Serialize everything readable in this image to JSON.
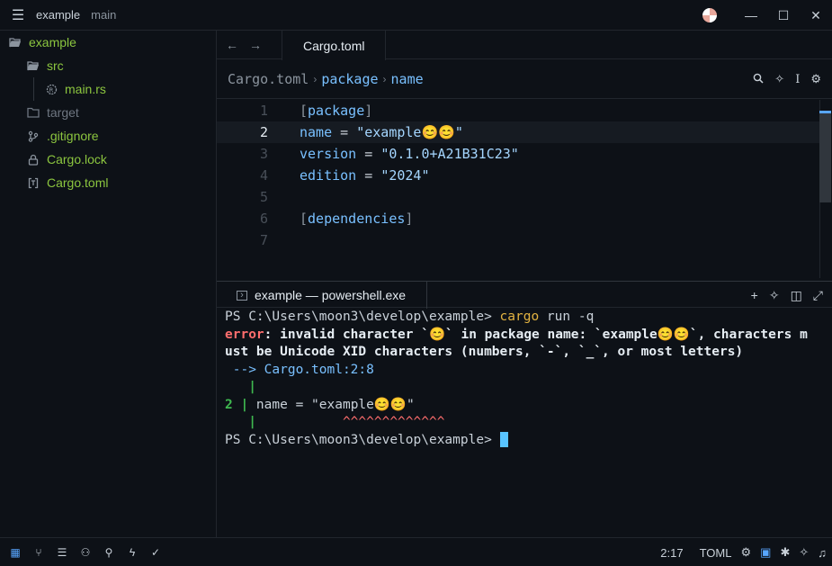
{
  "titlebar": {
    "project": "example",
    "branch": "main"
  },
  "sidebar": {
    "items": [
      {
        "label": "example",
        "icon": "folder-open-icon",
        "color": "#8cc63f"
      },
      {
        "label": "src",
        "icon": "folder-open-icon",
        "color": "#8cc63f"
      },
      {
        "label": "main.rs",
        "icon": "rust-icon",
        "color": "#8cc63f"
      },
      {
        "label": "target",
        "icon": "folder-icon",
        "color": "#6e7681"
      },
      {
        "label": ".gitignore",
        "icon": "git-icon",
        "color": "#8cc63f"
      },
      {
        "label": "Cargo.lock",
        "icon": "lock-icon",
        "color": "#8cc63f"
      },
      {
        "label": "Cargo.toml",
        "icon": "toml-icon",
        "color": "#8cc63f"
      }
    ]
  },
  "editor": {
    "tab": "Cargo.toml",
    "breadcrumb": [
      "Cargo.toml",
      "package",
      "name"
    ],
    "lines": [
      {
        "n": "1"
      },
      {
        "n": "2"
      },
      {
        "n": "3"
      },
      {
        "n": "4"
      },
      {
        "n": "5"
      },
      {
        "n": "6"
      },
      {
        "n": "7"
      }
    ],
    "code": {
      "l1_sec": "package",
      "l2_key": "name",
      "l2_val": "\"example😊😊\"",
      "l3_key": "version",
      "l3_val": "\"0.1.0+A21B31C23\"",
      "l4_key": "edition",
      "l4_val": "\"2024\"",
      "l6_sec": "dependencies"
    }
  },
  "terminal": {
    "tab": "example — powershell.exe",
    "prompt": "PS C:\\Users\\moon3\\develop\\example> ",
    "cmd": "cargo",
    "args": " run -q",
    "err_label": "error",
    "err_msg1": ": invalid character `😊` in package name: `example😊😊`, characters m",
    "err_msg2": "ust be Unicode XID characters (numbers, `-`, `_`, or most letters)",
    "loc": " --> Cargo.toml:2:8",
    "pipe": "   |",
    "ctx_num": "2 |",
    "ctx_code": " name = \"example😊😊\"",
    "caret_line": "           ^^^^^^^^^^^^^"
  },
  "status": {
    "position": "2:17",
    "language": "TOML"
  }
}
